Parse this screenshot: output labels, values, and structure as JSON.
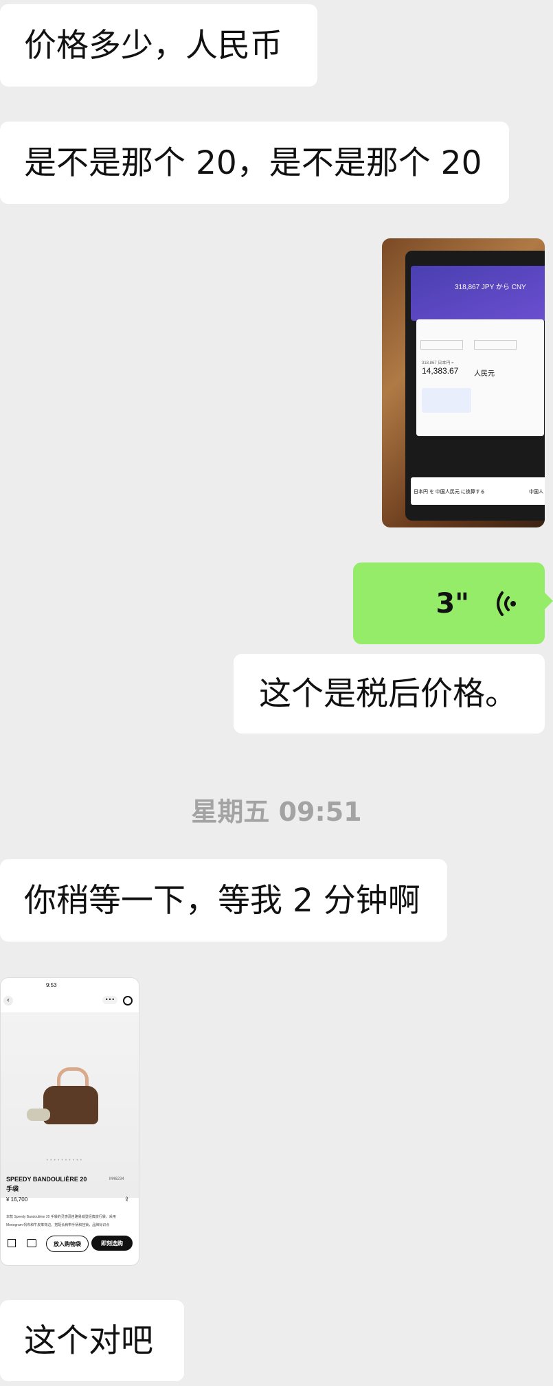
{
  "messages": {
    "m1": "价格多少，人民币",
    "m2": "是不是那个 20，是不是那个 20",
    "voice_duration": "3\"",
    "m4": "这个是税后价格。",
    "timestamp": "星期五 09:51",
    "m5": "你稍等一下，等我 2 分钟啊",
    "m6": "这个对吧"
  },
  "converter_screenshot": {
    "heading": "318,867 JPY から CNY",
    "result_small": "318,867 日本円 =",
    "result_value": "14,383.67",
    "result_unit": "人民元",
    "footer": "日本円 を 中国人民元 に換算する",
    "footer_right": "中国人"
  },
  "product_screenshot": {
    "status_time": "9:53",
    "title_line1": "SPEEDY BANDOULIÈRE 20",
    "title_line2": "手袋",
    "sku": "M46234",
    "price": "¥ 16,700",
    "desc1": "本款 Speedy Bandoulière 20 手袋的灵感源自路易威登经典旅行袋。采用",
    "desc2": "Monogram 帆布和牛皮革饰边，搭配长肩带手柄和挂锁，品牌标识点",
    "add_to_bag": "放入购物袋",
    "buy_now": "即刻选购"
  }
}
